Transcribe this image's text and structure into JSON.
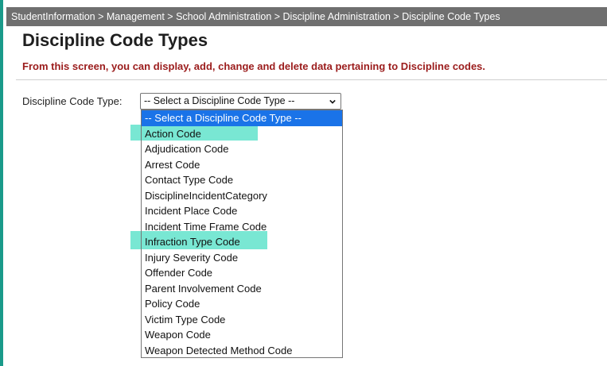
{
  "breadcrumb": "StudentInformation > Management > School Administration > Discipline Administration > Discipline Code Types",
  "page_title": "Discipline Code Types",
  "subtitle": "From this screen, you can display, add, change and delete data pertaining to Discipline codes.",
  "field": {
    "label": "Discipline Code Type:",
    "selected_value": "-- Select a Discipline Code Type --",
    "options": [
      "-- Select a Discipline Code Type --",
      "Action Code",
      "Adjudication Code",
      "Arrest Code",
      "Contact Type Code",
      "DisciplineIncidentCategory",
      "Incident Place Code",
      "Incident Time Frame Code",
      "Infraction Type Code",
      "Injury Severity Code",
      "Offender Code",
      "Parent Involvement Code",
      "Policy Code",
      "Victim Type Code",
      "Weapon Code",
      "Weapon Detected Method Code"
    ]
  },
  "icons": {
    "dropdown": "chevron-down-icon"
  },
  "colors": {
    "accent_border": "#1a9a8a",
    "breadcrumb_bg": "#6f6f6f",
    "subtitle_text": "#9b1c1c",
    "selected_option_bg": "#1a73e8",
    "highlight": "#61e3cb"
  }
}
